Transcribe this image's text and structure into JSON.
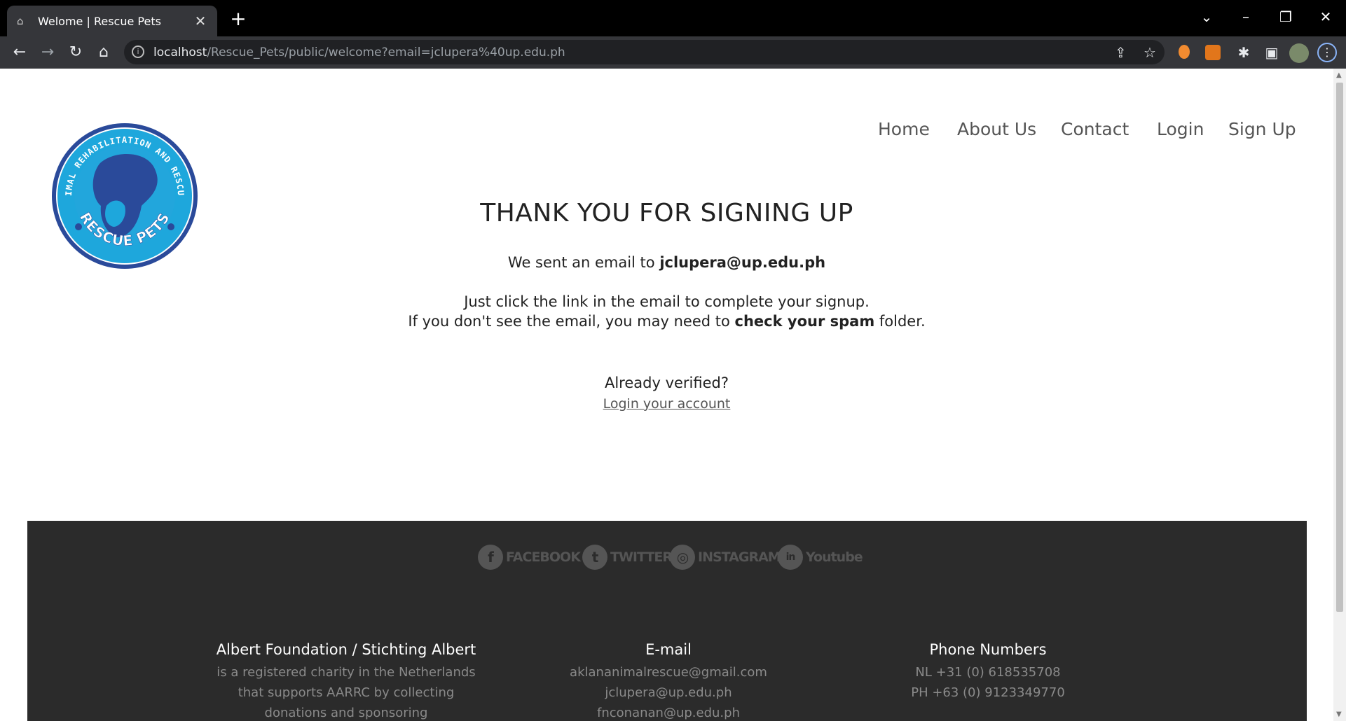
{
  "browser": {
    "tab_title": "Welome | Rescue Pets",
    "url_host": "localhost",
    "url_path": "/Rescue_Pets/public/welcome?email=jclupera%40up.edu.ph"
  },
  "logo": {
    "top_text": "AKLAN ANIMAL REHABILITATION AND RESCUE CENTER",
    "bottom_text": "RESCUE PETS",
    "color": "#1ea7dc"
  },
  "nav": {
    "items": [
      "Home",
      "About Us",
      "Contact",
      "Login",
      "Sign Up"
    ]
  },
  "main": {
    "headline": "THANK YOU FOR SIGNING UP",
    "sent_prefix": "We sent an email to",
    "email": "jclupera@up.edu.ph",
    "instruction": "Just click the link in the email to complete your signup.",
    "spam_prefix": "If you don't see the email, you may need to",
    "spam_bold": "check your spam",
    "spam_suffix": "folder.",
    "already": "Already verified?",
    "login_link": "Login your account"
  },
  "footer": {
    "social": [
      {
        "icon": "facebook-icon",
        "glyph": "f",
        "label": "FACEBOOK"
      },
      {
        "icon": "twitter-icon",
        "glyph": "t",
        "label": "TWITTER"
      },
      {
        "icon": "instagram-icon",
        "glyph": "◎",
        "label": "INSTAGRAM"
      },
      {
        "icon": "linkedin-icon",
        "glyph": "in",
        "label": "Youtube"
      }
    ],
    "org": {
      "title": "Albert Foundation / Stichting Albert",
      "lines": [
        "is a registered charity in the Netherlands",
        "that supports AARRC by collecting",
        "donations and sponsoring"
      ]
    },
    "email": {
      "title": "E-mail",
      "lines": [
        "aklananimalrescue@gmail.com",
        "jclupera@up.edu.ph",
        "fnconanan@up.edu.ph"
      ]
    },
    "phone": {
      "title": "Phone Numbers",
      "lines": [
        "NL +31 (0) 618535708",
        "PH +63 (0) 9123349770"
      ]
    },
    "bg_color": "#2b2b2b"
  }
}
